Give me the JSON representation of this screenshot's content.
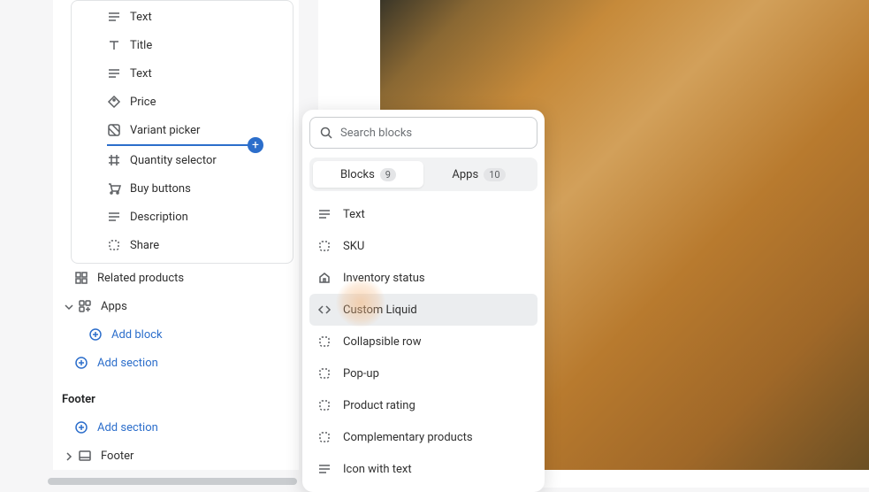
{
  "tree": {
    "text1": "Text",
    "title": "Title",
    "text2": "Text",
    "price": "Price",
    "variant_picker": "Variant picker",
    "quantity_selector": "Quantity selector",
    "buy_buttons": "Buy buttons",
    "description": "Description",
    "share": "Share",
    "related_products": "Related products",
    "apps": "Apps",
    "add_block": "Add block",
    "add_section": "Add section",
    "footer_heading": "Footer",
    "footer_item": "Footer"
  },
  "popover": {
    "search_placeholder": "Search blocks",
    "tabs": {
      "blocks": {
        "label": "Blocks",
        "count": "9"
      },
      "apps": {
        "label": "Apps",
        "count": "10"
      }
    },
    "items": {
      "text": "Text",
      "sku": "SKU",
      "inventory_status": "Inventory status",
      "custom_liquid": "Custom Liquid",
      "collapsible_row": "Collapsible row",
      "popup": "Pop-up",
      "product_rating": "Product rating",
      "complementary_products": "Complementary products",
      "icon_with_text": "Icon with text"
    }
  }
}
